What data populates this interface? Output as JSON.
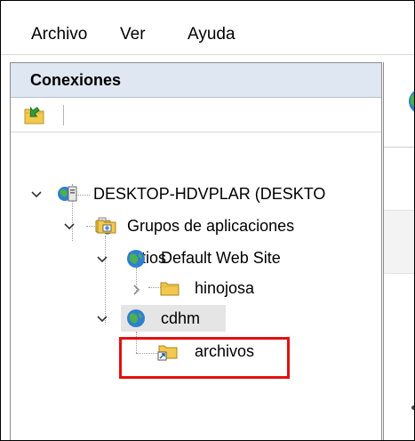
{
  "menu": {
    "items": [
      "Archivo",
      "Ver",
      "Ayuda"
    ]
  },
  "connections": {
    "title": "Conexiones",
    "tree": {
      "server": "DESKTOP-HDVPLAR (DESKTO",
      "app_pools": "Grupos de aplicaciones",
      "sites": "Sitios",
      "default_site": "Default Web Site",
      "default_child": "hinojosa",
      "site_cdhm": "cdhm",
      "cdhm_child": "archivos"
    }
  },
  "colors": {
    "highlight": "#e31010",
    "pane_header": "#dfe7f2",
    "selection": "#e5e5e5"
  }
}
